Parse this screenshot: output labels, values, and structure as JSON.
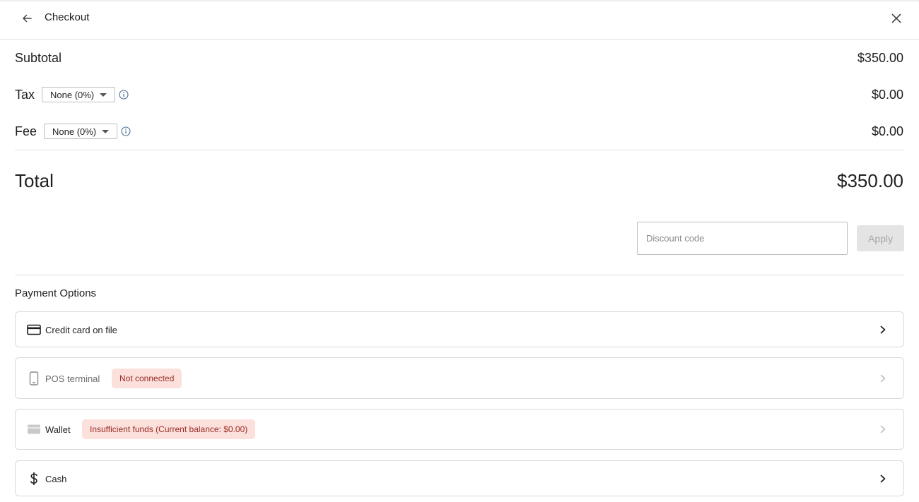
{
  "header": {
    "title": "Checkout",
    "back_icon": "arrow-left-icon",
    "close_icon": "close-icon"
  },
  "summary": {
    "subtotal": {
      "label": "Subtotal",
      "value": "$350.00"
    },
    "tax": {
      "label": "Tax",
      "selected": "None (0%)",
      "value": "$0.00"
    },
    "fee": {
      "label": "Fee",
      "selected": "None (0%)",
      "value": "$0.00"
    },
    "total": {
      "label": "Total",
      "value": "$350.00"
    }
  },
  "discount": {
    "placeholder": "Discount code",
    "value": "",
    "apply_label": "Apply"
  },
  "payment": {
    "title": "Payment Options",
    "options": [
      {
        "label": "Credit card on file",
        "icon": "credit-card-icon",
        "enabled": true
      },
      {
        "label": "POS terminal",
        "icon": "mobile-device-icon",
        "enabled": false,
        "badge": "Not connected"
      },
      {
        "label": "Wallet",
        "icon": "wallet-icon",
        "enabled": false,
        "badge": "Insufficient funds (Current balance: $0.00)"
      },
      {
        "label": "Cash",
        "icon": "dollar-icon",
        "enabled": true
      }
    ]
  },
  "colors": {
    "badge_bg": "#fbe0dc",
    "badge_text": "#9a2a22",
    "border": "#dadada",
    "disabled_button": "#e4e4e4"
  }
}
